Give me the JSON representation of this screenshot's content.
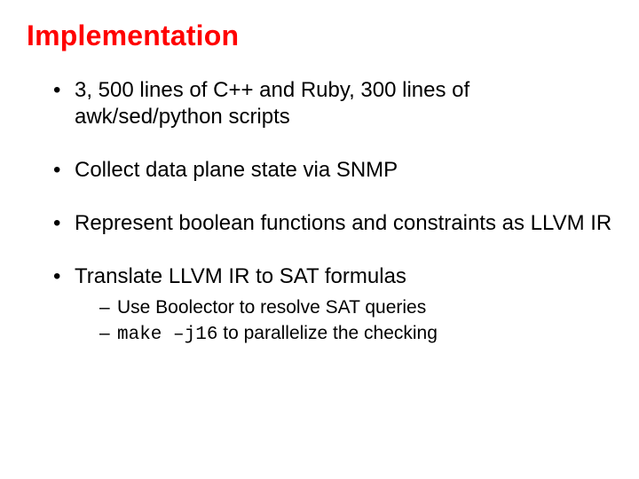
{
  "title": "Implementation",
  "bullets": {
    "b1": "3, 500 lines of C++ and Ruby, 300 lines of awk/sed/python scripts",
    "b2": "Collect data plane state via SNMP",
    "b3": "Represent boolean functions and constraints as LLVM IR",
    "b4": "Translate LLVM IR to SAT formulas",
    "b4_sub1": "Use Boolector to resolve SAT queries",
    "b4_sub2_code": "make –j16",
    "b4_sub2_rest": " to parallelize the checking"
  }
}
